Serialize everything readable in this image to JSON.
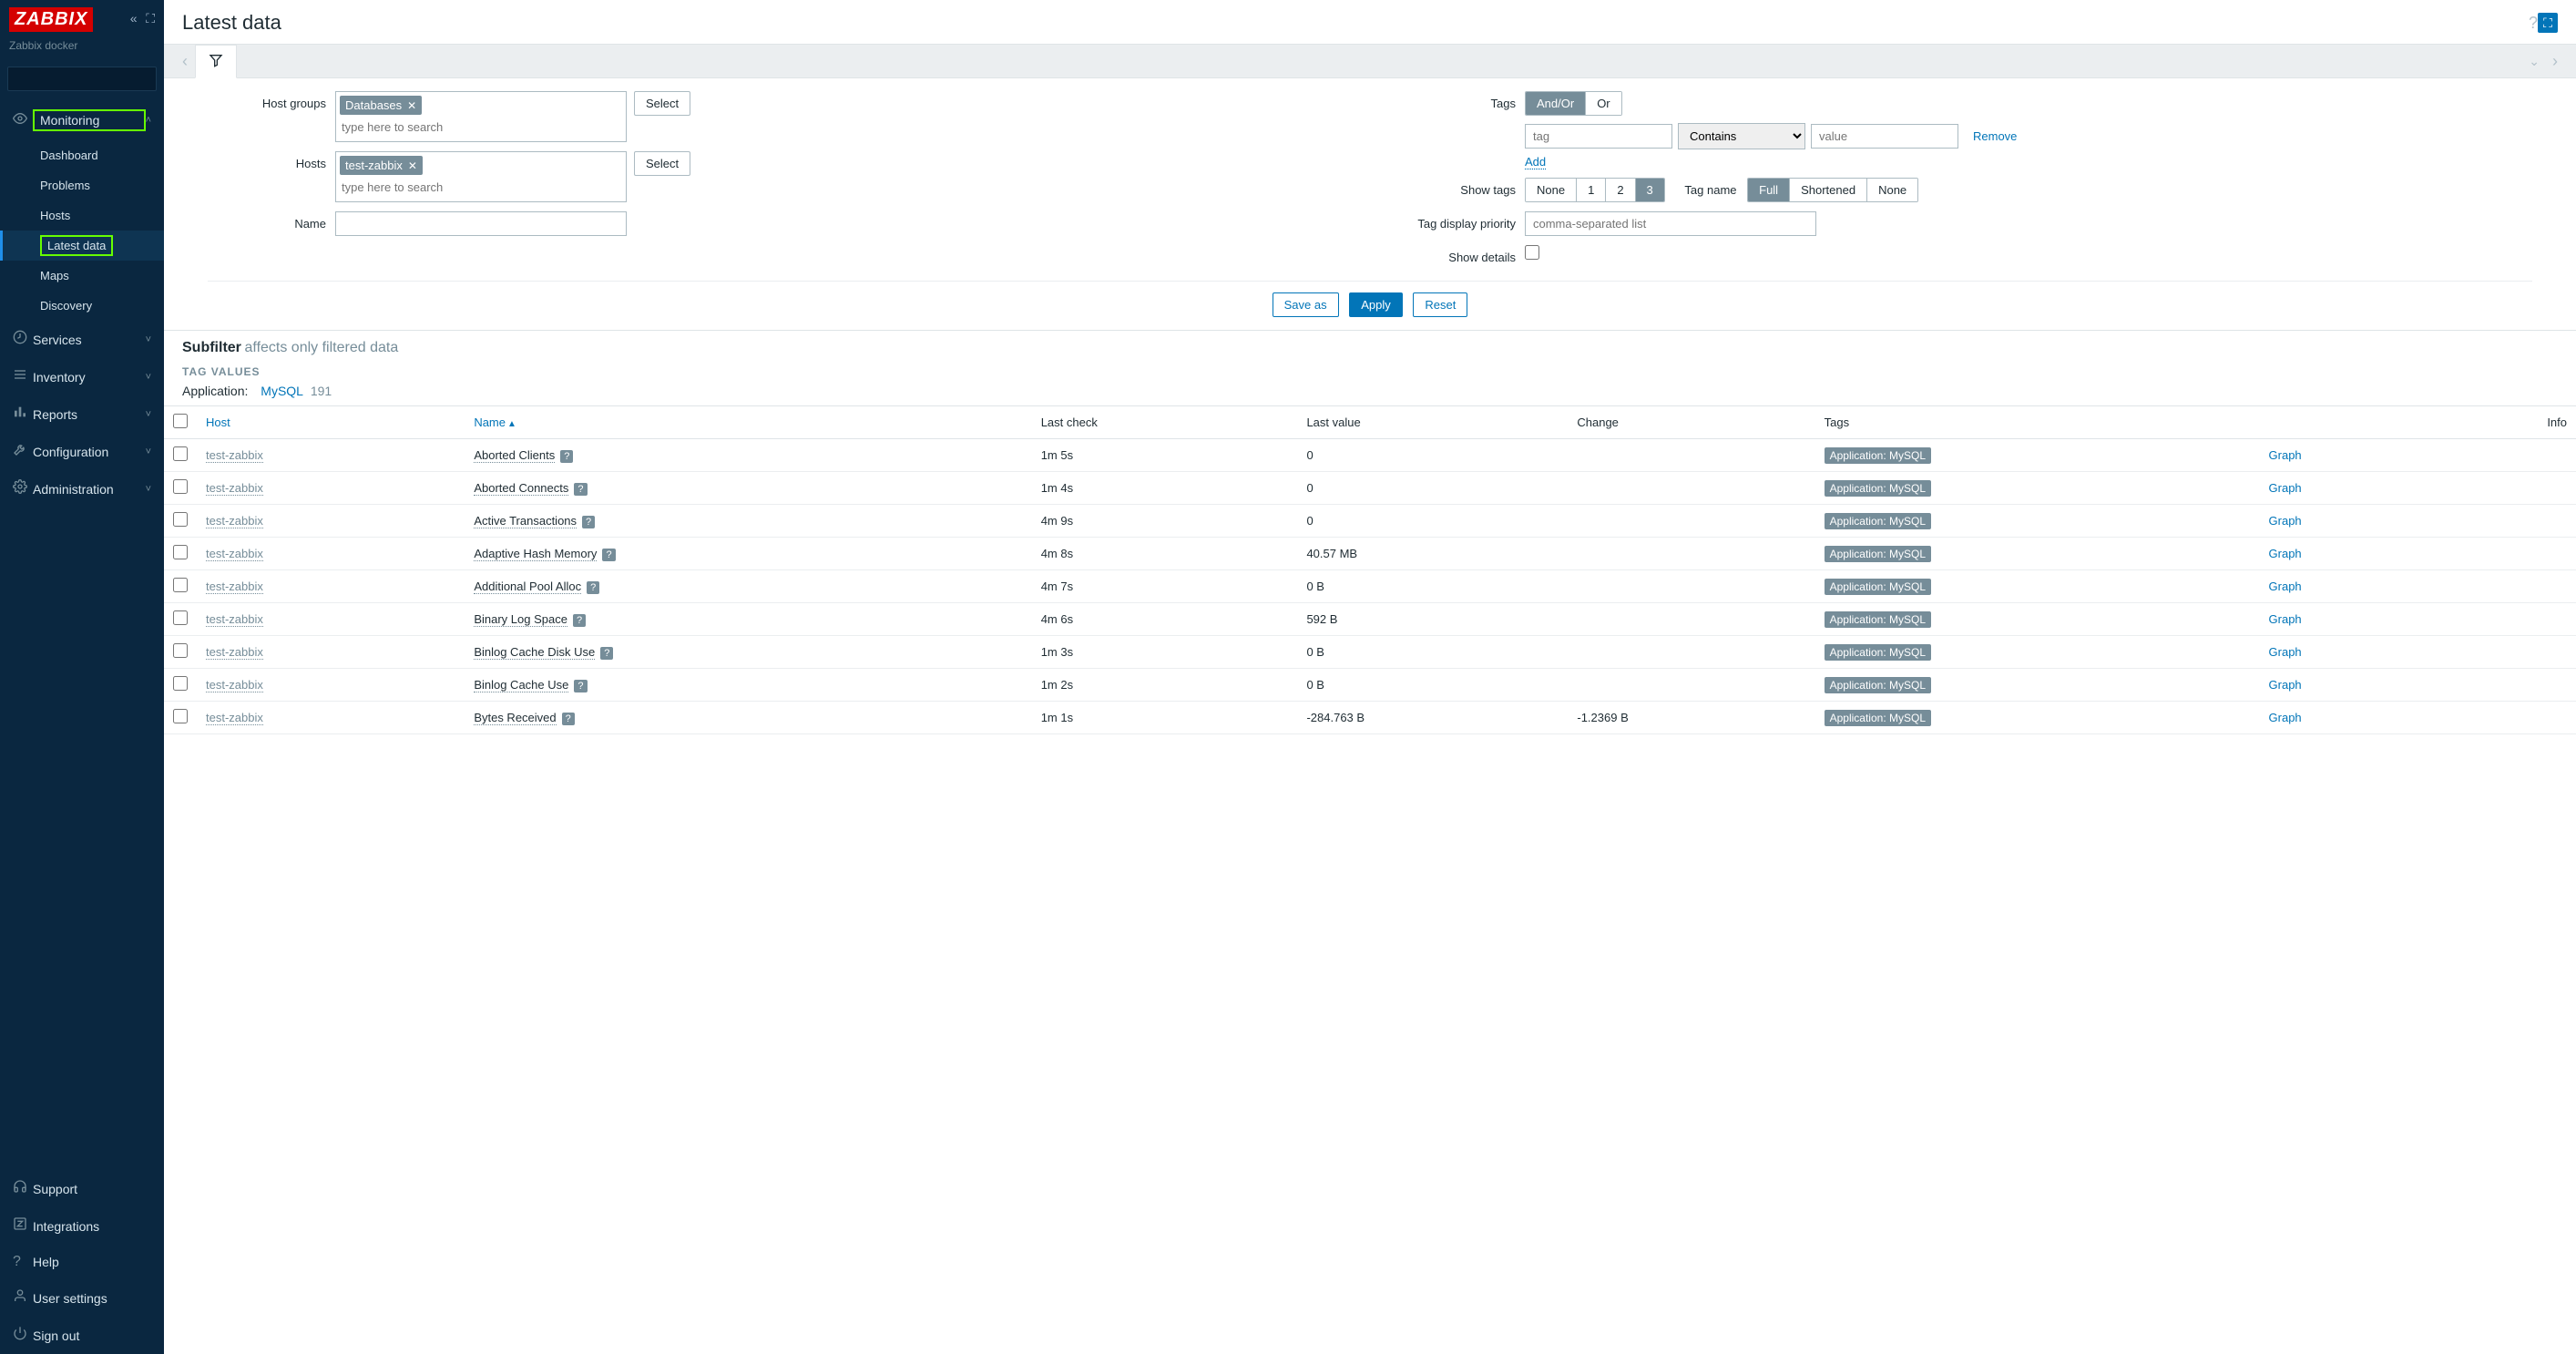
{
  "sidebar": {
    "logo": "ZABBIX",
    "server_name": "Zabbix docker",
    "nav": [
      {
        "label": "Monitoring",
        "icon": "eye",
        "highlighted": true,
        "expanded": true,
        "sub": [
          {
            "label": "Dashboard"
          },
          {
            "label": "Problems"
          },
          {
            "label": "Hosts"
          },
          {
            "label": "Latest data",
            "active": true,
            "highlighted": true
          },
          {
            "label": "Maps"
          },
          {
            "label": "Discovery"
          }
        ]
      },
      {
        "label": "Services",
        "icon": "clock"
      },
      {
        "label": "Inventory",
        "icon": "list"
      },
      {
        "label": "Reports",
        "icon": "bar"
      },
      {
        "label": "Configuration",
        "icon": "wrench"
      },
      {
        "label": "Administration",
        "icon": "gear"
      }
    ],
    "bottom": [
      {
        "label": "Support",
        "icon": "headset"
      },
      {
        "label": "Integrations",
        "icon": "z"
      },
      {
        "label": "Help",
        "icon": "question"
      },
      {
        "label": "User settings",
        "icon": "user"
      },
      {
        "label": "Sign out",
        "icon": "power"
      }
    ]
  },
  "header": {
    "title": "Latest data"
  },
  "filter": {
    "host_groups_label": "Host groups",
    "host_groups_tags": [
      "Databases"
    ],
    "hosts_label": "Hosts",
    "hosts_tags": [
      "test-zabbix"
    ],
    "name_label": "Name",
    "search_placeholder": "type here to search",
    "select_label": "Select",
    "tags_label": "Tags",
    "tags_andor": "And/Or",
    "tags_or": "Or",
    "tag_placeholder": "tag",
    "tag_op": "Contains",
    "tag_value_placeholder": "value",
    "remove_label": "Remove",
    "add_label": "Add",
    "show_tags_label": "Show tags",
    "show_tags_opts": [
      "None",
      "1",
      "2",
      "3"
    ],
    "show_tags_active": "3",
    "tag_name_label": "Tag name",
    "tag_name_opts": [
      "Full",
      "Shortened",
      "None"
    ],
    "tag_name_active": "Full",
    "tag_priority_label": "Tag display priority",
    "tag_priority_placeholder": "comma-separated list",
    "show_details_label": "Show details",
    "save_as": "Save as",
    "apply": "Apply",
    "reset": "Reset"
  },
  "subfilter": {
    "title": "Subfilter",
    "hint": "affects only filtered data",
    "section_label": "TAG VALUES",
    "key": "Application:",
    "value": "MySQL",
    "count": "191"
  },
  "table": {
    "columns": {
      "host": "Host",
      "name": "Name",
      "last_check": "Last check",
      "last_value": "Last value",
      "change": "Change",
      "tags": "Tags",
      "info": "Info"
    },
    "tag_pill": "Application: MySQL",
    "graph_label": "Graph",
    "rows": [
      {
        "host": "test-zabbix",
        "name": "Aborted Clients",
        "last_check": "1m 5s",
        "last_value": "0",
        "change": ""
      },
      {
        "host": "test-zabbix",
        "name": "Aborted Connects",
        "last_check": "1m 4s",
        "last_value": "0",
        "change": ""
      },
      {
        "host": "test-zabbix",
        "name": "Active Transactions",
        "last_check": "4m 9s",
        "last_value": "0",
        "change": ""
      },
      {
        "host": "test-zabbix",
        "name": "Adaptive Hash Memory",
        "last_check": "4m 8s",
        "last_value": "40.57 MB",
        "change": ""
      },
      {
        "host": "test-zabbix",
        "name": "Additional Pool Alloc",
        "last_check": "4m 7s",
        "last_value": "0 B",
        "change": ""
      },
      {
        "host": "test-zabbix",
        "name": "Binary Log Space",
        "last_check": "4m 6s",
        "last_value": "592 B",
        "change": ""
      },
      {
        "host": "test-zabbix",
        "name": "Binlog Cache Disk Use",
        "last_check": "1m 3s",
        "last_value": "0 B",
        "change": ""
      },
      {
        "host": "test-zabbix",
        "name": "Binlog Cache Use",
        "last_check": "1m 2s",
        "last_value": "0 B",
        "change": ""
      },
      {
        "host": "test-zabbix",
        "name": "Bytes Received",
        "last_check": "1m 1s",
        "last_value": "-284.763 B",
        "change": "-1.2369 B"
      }
    ]
  }
}
